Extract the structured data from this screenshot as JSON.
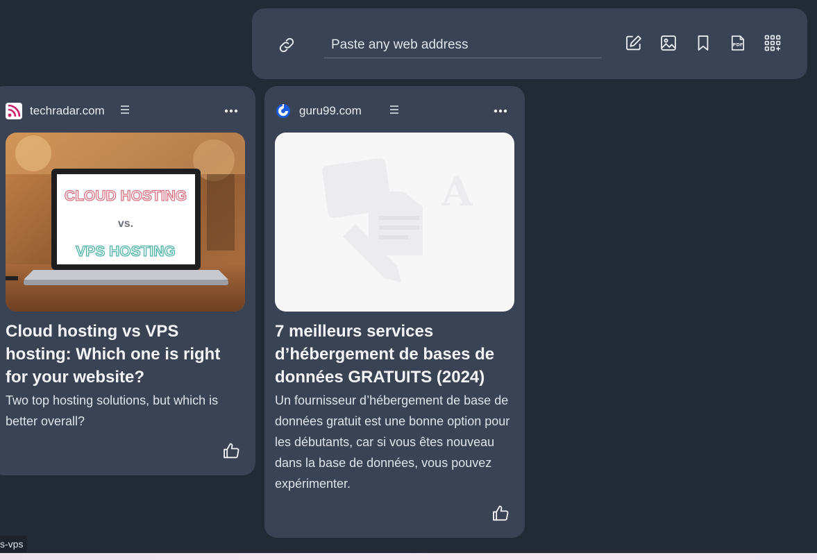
{
  "toolbar": {
    "url_placeholder": "Paste any web address",
    "icons": [
      "link-icon",
      "note-edit-icon",
      "image-icon",
      "bookmark-icon",
      "pdf-icon",
      "apps-add-icon"
    ],
    "pdf_label": "PDF"
  },
  "cards": [
    {
      "site": "techradar.com",
      "favicon": "rss-icon",
      "favicon_color": "#d11c6a",
      "image_text": [
        "CLOUD HOSTING",
        "vs.",
        "VPS HOSTING"
      ],
      "title": "Cloud hosting vs VPS hosting: Which one is right for your website?",
      "description": "Two top hosting solutions, but which is better overall?"
    },
    {
      "site": "guru99.com",
      "favicon": "guru99-icon",
      "favicon_color": "#1a5be0",
      "image": "placeholder-media-icon",
      "title": "7 meilleurs services d’hébergement de bases de données GRATUITS (2024)",
      "description": "Un fournisseur d’hébergement de base de données gratuit est une bonne option pour les débutants, car si vous êtes nouveau dans la base de données, vous pouvez expérimenter."
    }
  ],
  "status_text": "s-vps"
}
